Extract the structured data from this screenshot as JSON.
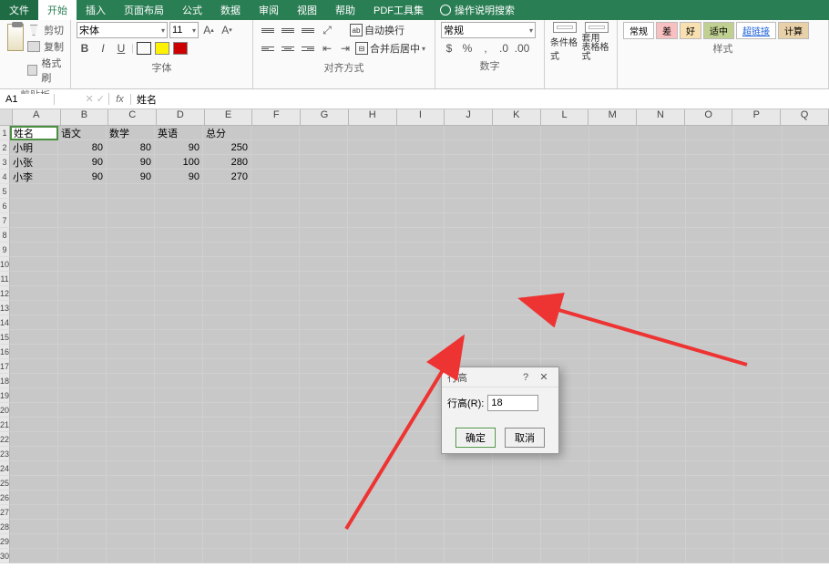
{
  "menu": {
    "file": "文件",
    "home": "开始",
    "insert": "插入",
    "layout": "页面布局",
    "formula": "公式",
    "data": "数据",
    "review": "审阅",
    "view": "视图",
    "help": "帮助",
    "pdf": "PDF工具集",
    "hint": "操作说明搜索"
  },
  "ribbon": {
    "clipboard": {
      "cut": "剪切",
      "copy": "复制",
      "format": "格式刷",
      "paste": "粘贴",
      "label": "剪贴板"
    },
    "font": {
      "name": "宋体",
      "size": "11",
      "label": "字体",
      "b": "B",
      "i": "I",
      "u": "U"
    },
    "align": {
      "wrap": "自动换行",
      "merge": "合并后居中",
      "label": "对齐方式"
    },
    "number": {
      "format": "常规",
      "label": "数字"
    },
    "styles": {
      "cond": "条件格式",
      "table": "套用\n表格格式",
      "label": "样式",
      "normal": "常规",
      "bad": "差",
      "good": "好",
      "medium": "适中",
      "link": "超链接",
      "calc": "计算"
    }
  },
  "formula_bar": {
    "namebox": "A1",
    "fx": "fx",
    "value": "姓名"
  },
  "columns": [
    "A",
    "B",
    "C",
    "D",
    "E",
    "F",
    "G",
    "H",
    "I",
    "J",
    "K",
    "L",
    "M",
    "N",
    "O",
    "P",
    "Q"
  ],
  "sheet": {
    "headers": [
      "姓名",
      "语文",
      "数学",
      "英语",
      "总分"
    ],
    "rows": [
      {
        "name": "小明",
        "v": [
          80,
          80,
          90,
          250
        ]
      },
      {
        "name": "小张",
        "v": [
          90,
          90,
          100,
          280
        ]
      },
      {
        "name": "小李",
        "v": [
          90,
          90,
          90,
          270
        ]
      }
    ]
  },
  "dialog": {
    "title": "行高",
    "label": "行高(R):",
    "value": "18",
    "ok": "确定",
    "cancel": "取消"
  },
  "chart_data": {
    "type": "table",
    "title": "",
    "headers": [
      "姓名",
      "语文",
      "数学",
      "英语",
      "总分"
    ],
    "rows": [
      [
        "小明",
        80,
        80,
        90,
        250
      ],
      [
        "小张",
        90,
        90,
        100,
        280
      ],
      [
        "小李",
        90,
        90,
        90,
        270
      ]
    ]
  }
}
